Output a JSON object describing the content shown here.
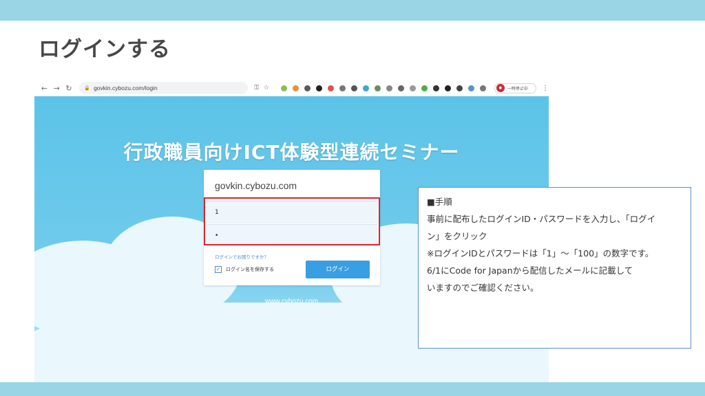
{
  "slide": {
    "title": "ログインする",
    "colors": {
      "band": "#99d5e5",
      "title_text": "#474747",
      "note_border": "#5b8fd0"
    }
  },
  "browser": {
    "back_icon": "arrow-left-icon",
    "forward_icon": "arrow-right-icon",
    "reload_icon": "reload-icon",
    "url": "govkin.cybozu.com/login",
    "profile_label": "一時停止中"
  },
  "login_page": {
    "heading": "行政職員向けICT体験型連続セミナー",
    "domain": "govkin.cybozu.com",
    "id_value": "1",
    "password_value": "•",
    "forgot_link": "ログインでお困りですか？",
    "remember_label": "ログイン名を保存する",
    "login_button": "ログイン",
    "footer_link": "www.cybozu.com",
    "colors": {
      "button": "#3a9ee2",
      "highlight": "#d7262d",
      "sky": "#5cc3e8"
    }
  },
  "note": {
    "lines": [
      "■手順",
      "事前に配布したログインID・パスワードを入力し、「ログイ",
      "ン」をクリック",
      "",
      "※ログインIDとパスワードは「1」～「100」の数字です。",
      "6/1にCode for Japanから配信したメールに記載して",
      "いますのでご確認ください。"
    ]
  }
}
